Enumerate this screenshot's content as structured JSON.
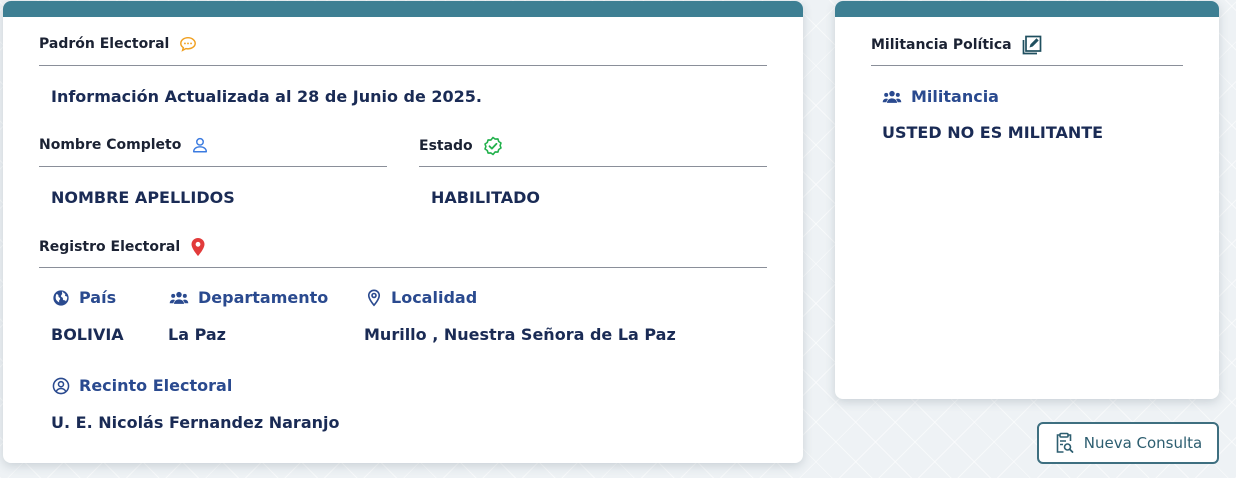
{
  "padron": {
    "title": "Padrón Electoral",
    "info": "Información Actualizada al 28 de Junio de 2025."
  },
  "nombre": {
    "label": "Nombre Completo",
    "value": "NOMBRE APELLIDOS"
  },
  "estado": {
    "label": "Estado",
    "value": "HABILITADO"
  },
  "registro": {
    "title": "Registro Electoral",
    "pais": {
      "label": "País",
      "value": "BOLIVIA"
    },
    "departamento": {
      "label": "Departamento",
      "value": "La Paz"
    },
    "localidad": {
      "label": "Localidad",
      "value": "Murillo , Nuestra Señora de La Paz"
    },
    "recinto": {
      "label": "Recinto Electoral",
      "value": "U. E. Nicolás Fernandez Naranjo"
    }
  },
  "militancia": {
    "title": "Militancia Política",
    "label": "Militancia",
    "value": "USTED NO ES MILITANTE"
  },
  "actions": {
    "nueva_consulta": "Nueva Consulta"
  },
  "colors": {
    "header_bar": "#3e7f93",
    "value_text": "#1a2b55",
    "label_blue": "#2a4a8f",
    "chat_icon": "#f0a020",
    "check_icon": "#22b14c",
    "pin_icon": "#e23b3b",
    "user_icon": "#3b7be0"
  },
  "icons": [
    "chat-icon",
    "user-icon",
    "verified-check-icon",
    "map-pin-icon",
    "globe-icon",
    "users-icon",
    "location-pin-icon",
    "user-circle-icon",
    "edit-square-icon",
    "clipboard-search-icon"
  ]
}
